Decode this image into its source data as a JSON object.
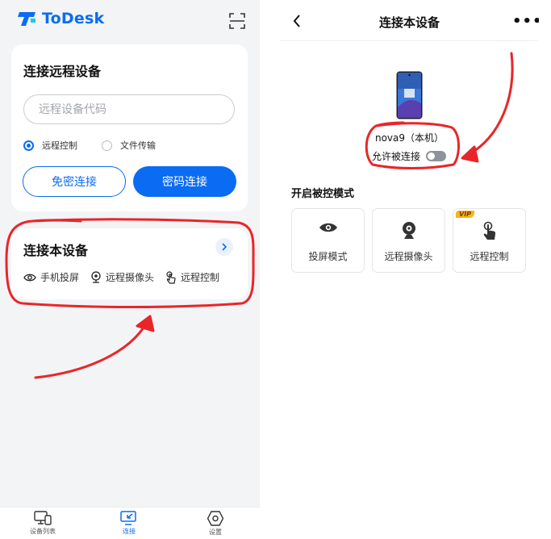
{
  "colors": {
    "accent": "#0a6cf2",
    "annotation": "#e8262a",
    "toggle_off": "#8e9399",
    "vip": "#f6b51a"
  },
  "left": {
    "header": {
      "brand": "ToDesk",
      "logo_icon": "todesk-logo-icon",
      "scan_icon": "scan-icon"
    },
    "connect_remote": {
      "title": "连接远程设备",
      "code_placeholder": "远程设备代码",
      "options": [
        {
          "label": "远程控制",
          "selected": true
        },
        {
          "label": "文件传输",
          "selected": false
        }
      ],
      "btn_no_password": "免密连接",
      "btn_password": "密码连接"
    },
    "connect_local": {
      "title": "连接本设备",
      "features": [
        {
          "icon": "eye-icon",
          "label": "手机投屏"
        },
        {
          "icon": "webcam-icon",
          "label": "远程摄像头"
        },
        {
          "icon": "touch-hand-icon",
          "label": "远程控制"
        }
      ]
    },
    "bottom_nav": [
      {
        "icon": "device-list-icon",
        "label": "设备列表",
        "active": false
      },
      {
        "icon": "connect-icon",
        "label": "连接",
        "active": true
      },
      {
        "icon": "settings-icon",
        "label": "设置",
        "active": false
      }
    ]
  },
  "right": {
    "title": "连接本设备",
    "device_name": "nova9（本机）",
    "allow_label": "允许被连接",
    "allow_enabled": false,
    "section_title": "开启被控模式",
    "modes": [
      {
        "icon": "eye-icon",
        "label": "投屏模式",
        "badge": ""
      },
      {
        "icon": "webcam-icon",
        "label": "远程摄像头",
        "badge": ""
      },
      {
        "icon": "touch-hand-icon",
        "label": "远程控制",
        "badge": "VIP"
      }
    ]
  }
}
